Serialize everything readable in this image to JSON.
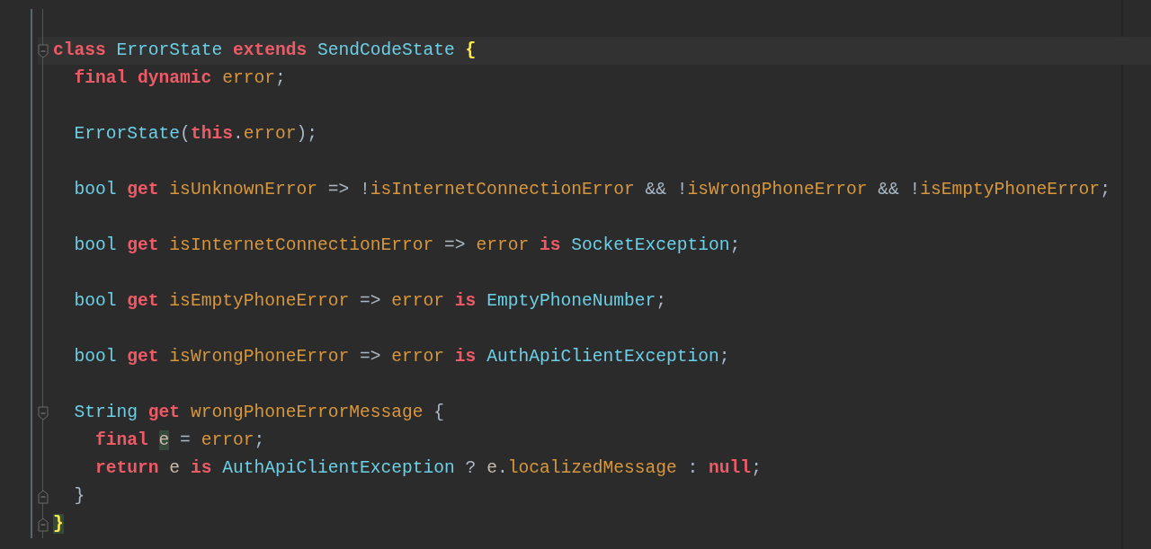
{
  "editor": {
    "lines": [
      {
        "current": false,
        "fold_start": false,
        "fold_end": false
      },
      {
        "current": true,
        "fold_start": true,
        "fold_end": false,
        "tokens": [
          {
            "kind": "kw",
            "text": "class ",
            "marked": false
          },
          {
            "kind": "type",
            "text": "ErrorState ",
            "marked": false
          },
          {
            "kind": "kw",
            "text": "extends ",
            "marked": false
          },
          {
            "kind": "type",
            "text": "SendCodeState ",
            "marked": false
          },
          {
            "kind": "brace",
            "text": "{",
            "marked": false
          }
        ]
      },
      {
        "current": false,
        "fold_start": false,
        "fold_end": false,
        "tokens": [
          {
            "kind": "kw",
            "text": "  final dynamic ",
            "marked": false
          },
          {
            "kind": "field",
            "text": "error",
            "marked": false
          },
          {
            "kind": "punct",
            "text": ";",
            "marked": false
          }
        ]
      },
      {
        "current": false,
        "fold_start": false,
        "fold_end": false
      },
      {
        "current": false,
        "fold_start": false,
        "fold_end": false,
        "tokens": [
          {
            "kind": "type",
            "text": "  ErrorState",
            "marked": false
          },
          {
            "kind": "punct",
            "text": "(",
            "marked": false
          },
          {
            "kind": "kw",
            "text": "this",
            "marked": false
          },
          {
            "kind": "punct",
            "text": ".",
            "marked": false
          },
          {
            "kind": "field",
            "text": "error",
            "marked": false
          },
          {
            "kind": "punct",
            "text": ");",
            "marked": false
          }
        ]
      },
      {
        "current": false,
        "fold_start": false,
        "fold_end": false
      },
      {
        "current": false,
        "fold_start": false,
        "fold_end": false,
        "tokens": [
          {
            "kind": "type",
            "text": "  bool ",
            "marked": false
          },
          {
            "kind": "kw",
            "text": "get ",
            "marked": false
          },
          {
            "kind": "field",
            "text": "isUnknownError",
            "marked": false
          },
          {
            "kind": "punct",
            "text": " => !",
            "marked": false
          },
          {
            "kind": "field",
            "text": "isInternetConnectionError",
            "marked": false
          },
          {
            "kind": "punct",
            "text": " && !",
            "marked": false
          },
          {
            "kind": "field",
            "text": "isWrongPhoneError",
            "marked": false
          },
          {
            "kind": "punct",
            "text": " && !",
            "marked": false
          },
          {
            "kind": "field",
            "text": "isEmptyPhoneError",
            "marked": false
          },
          {
            "kind": "punct",
            "text": ";",
            "marked": false
          }
        ]
      },
      {
        "current": false,
        "fold_start": false,
        "fold_end": false
      },
      {
        "current": false,
        "fold_start": false,
        "fold_end": false,
        "tokens": [
          {
            "kind": "type",
            "text": "  bool ",
            "marked": false
          },
          {
            "kind": "kw",
            "text": "get ",
            "marked": false
          },
          {
            "kind": "field",
            "text": "isInternetConnectionError",
            "marked": false
          },
          {
            "kind": "punct",
            "text": " => ",
            "marked": false
          },
          {
            "kind": "field",
            "text": "error ",
            "marked": false
          },
          {
            "kind": "kw",
            "text": "is ",
            "marked": false
          },
          {
            "kind": "type",
            "text": "SocketException",
            "marked": false
          },
          {
            "kind": "punct",
            "text": ";",
            "marked": false
          }
        ]
      },
      {
        "current": false,
        "fold_start": false,
        "fold_end": false
      },
      {
        "current": false,
        "fold_start": false,
        "fold_end": false,
        "tokens": [
          {
            "kind": "type",
            "text": "  bool ",
            "marked": false
          },
          {
            "kind": "kw",
            "text": "get ",
            "marked": false
          },
          {
            "kind": "field",
            "text": "isEmptyPhoneError",
            "marked": false
          },
          {
            "kind": "punct",
            "text": " => ",
            "marked": false
          },
          {
            "kind": "field",
            "text": "error ",
            "marked": false
          },
          {
            "kind": "kw",
            "text": "is ",
            "marked": false
          },
          {
            "kind": "type",
            "text": "EmptyPhoneNumber",
            "marked": false
          },
          {
            "kind": "punct",
            "text": ";",
            "marked": false
          }
        ]
      },
      {
        "current": false,
        "fold_start": false,
        "fold_end": false
      },
      {
        "current": false,
        "fold_start": false,
        "fold_end": false,
        "tokens": [
          {
            "kind": "type",
            "text": "  bool ",
            "marked": false
          },
          {
            "kind": "kw",
            "text": "get ",
            "marked": false
          },
          {
            "kind": "field",
            "text": "isWrongPhoneError",
            "marked": false
          },
          {
            "kind": "punct",
            "text": " => ",
            "marked": false
          },
          {
            "kind": "field",
            "text": "error ",
            "marked": false
          },
          {
            "kind": "kw",
            "text": "is ",
            "marked": false
          },
          {
            "kind": "type",
            "text": "AuthApiClientException",
            "marked": false
          },
          {
            "kind": "punct",
            "text": ";",
            "marked": false
          }
        ]
      },
      {
        "current": false,
        "fold_start": false,
        "fold_end": false
      },
      {
        "current": false,
        "fold_start": true,
        "fold_end": false,
        "tokens": [
          {
            "kind": "type",
            "text": "  String ",
            "marked": false
          },
          {
            "kind": "kw",
            "text": "get ",
            "marked": false
          },
          {
            "kind": "field",
            "text": "wrongPhoneErrorMessage",
            "marked": false
          },
          {
            "kind": "punct",
            "text": " {",
            "marked": false
          }
        ]
      },
      {
        "current": false,
        "fold_start": false,
        "fold_end": false,
        "tokens": [
          {
            "kind": "kw",
            "text": "    final ",
            "marked": false
          },
          {
            "kind": "var",
            "text": "e",
            "marked": true
          },
          {
            "kind": "punct",
            "text": " = ",
            "marked": false
          },
          {
            "kind": "field",
            "text": "error",
            "marked": false
          },
          {
            "kind": "punct",
            "text": ";",
            "marked": false
          }
        ]
      },
      {
        "current": false,
        "fold_start": false,
        "fold_end": false,
        "tokens": [
          {
            "kind": "kw",
            "text": "    return ",
            "marked": false
          },
          {
            "kind": "var",
            "text": "e ",
            "marked": false
          },
          {
            "kind": "kw",
            "text": "is ",
            "marked": false
          },
          {
            "kind": "type",
            "text": "AuthApiClientException",
            "marked": false
          },
          {
            "kind": "punct",
            "text": " ? ",
            "marked": false
          },
          {
            "kind": "var",
            "text": "e",
            "marked": false
          },
          {
            "kind": "punct",
            "text": ".",
            "marked": false
          },
          {
            "kind": "field",
            "text": "localizedMessage",
            "marked": false
          },
          {
            "kind": "punct",
            "text": " : ",
            "marked": false
          },
          {
            "kind": "kw",
            "text": "null",
            "marked": false
          },
          {
            "kind": "punct",
            "text": ";",
            "marked": false
          }
        ]
      },
      {
        "current": false,
        "fold_start": false,
        "fold_end": true,
        "tokens": [
          {
            "kind": "punct",
            "text": "  }",
            "marked": false
          }
        ]
      },
      {
        "current": false,
        "fold_start": false,
        "fold_end": true,
        "tokens": [
          {
            "kind": "brace",
            "text": "}",
            "marked": true
          }
        ]
      }
    ]
  }
}
